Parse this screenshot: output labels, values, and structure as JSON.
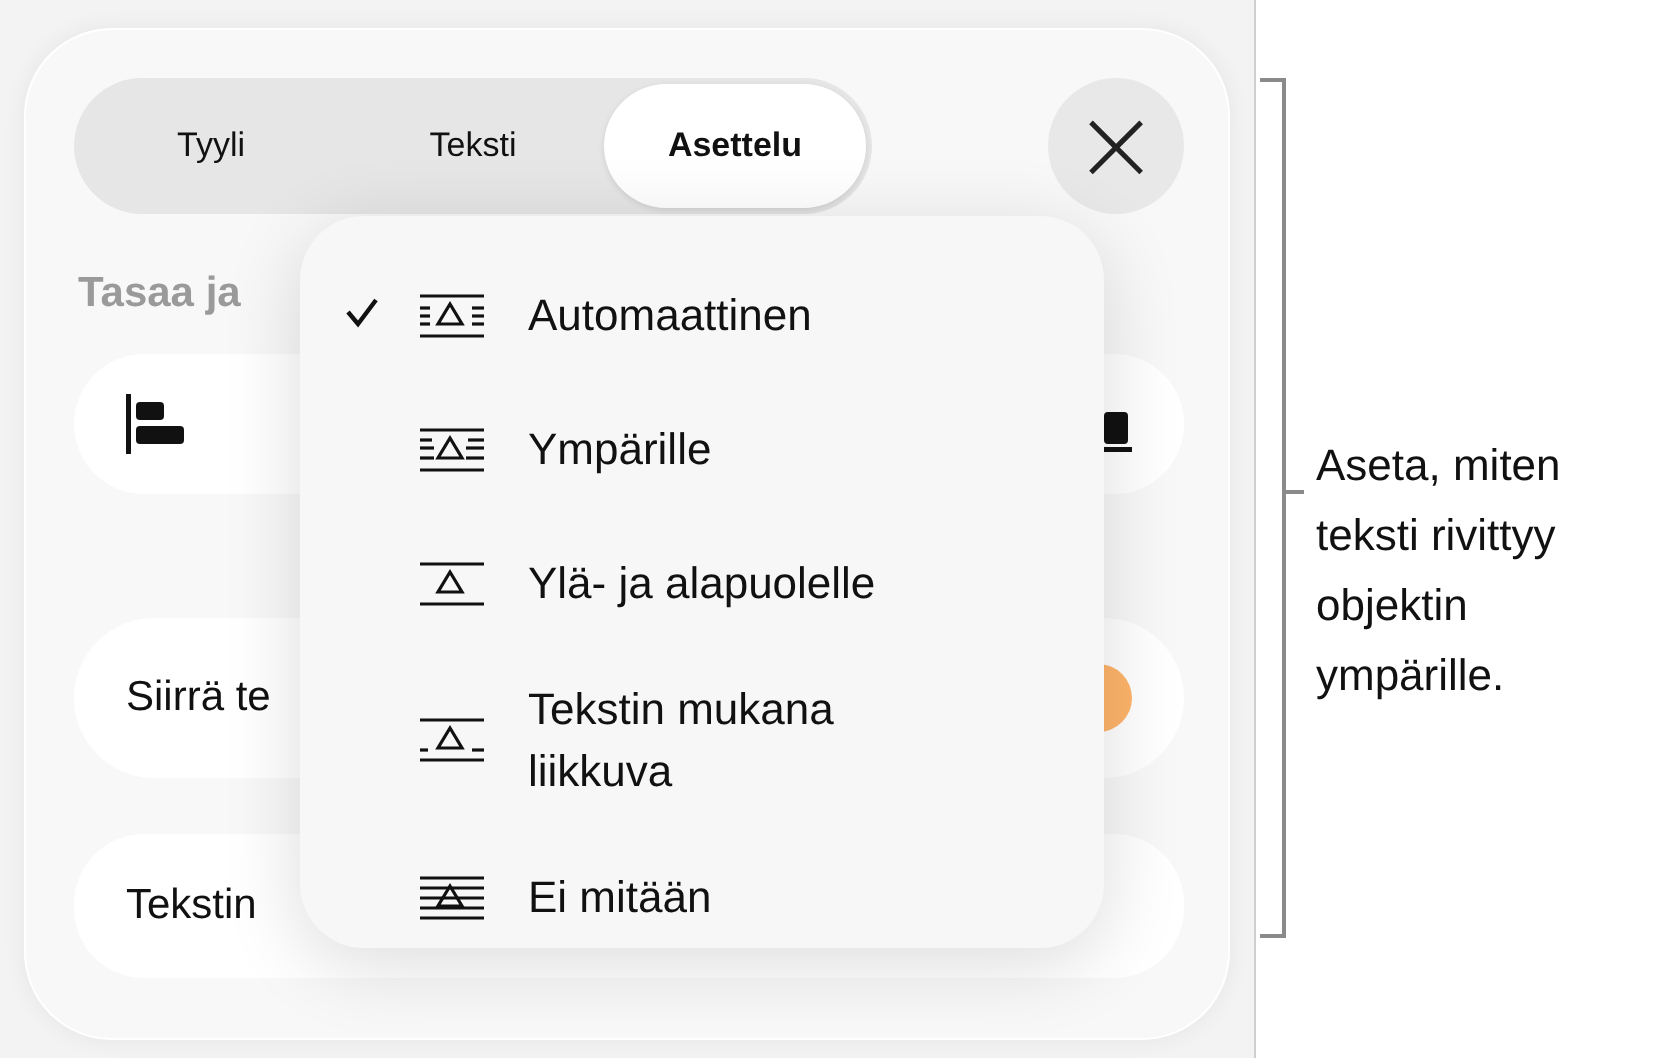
{
  "tabs": [
    {
      "label": "Tyyli",
      "selected": false
    },
    {
      "label": "Teksti",
      "selected": false
    },
    {
      "label": "Asettelu",
      "selected": true
    }
  ],
  "close_button": {
    "label": "×"
  },
  "section_heading": "Tasaa ja",
  "rows": [
    {
      "kind": "alignment"
    },
    {
      "kind": "toggle",
      "label": "Siirrä te",
      "on": true
    },
    {
      "kind": "plain",
      "label": "Tekstin"
    }
  ],
  "wrap_menu": [
    {
      "label": "Automaattinen",
      "kind": "automatic",
      "selected": true
    },
    {
      "label": "Ympärille",
      "kind": "around",
      "selected": false
    },
    {
      "label": "Ylä- ja alapuolelle",
      "kind": "above_below",
      "selected": false
    },
    {
      "label": "Tekstin mukana liikkuva",
      "kind": "inline",
      "selected": false
    },
    {
      "label": "Ei mitään",
      "kind": "none",
      "selected": false
    }
  ],
  "callout": "Aseta, miten teksti rivittyy objektin ympärille."
}
